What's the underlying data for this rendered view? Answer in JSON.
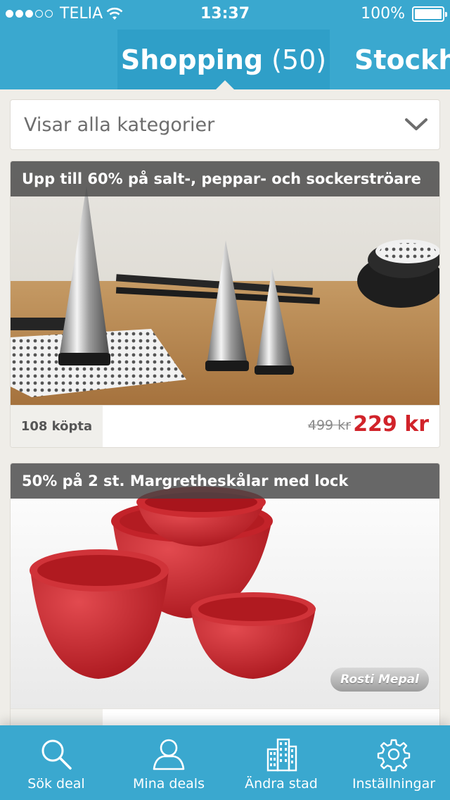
{
  "status_bar": {
    "carrier": "TELIA",
    "time": "13:37",
    "battery": "100%",
    "signal_bars_filled": 3,
    "signal_bars_total": 5
  },
  "header": {
    "active_tab_title": "Shopping",
    "active_tab_count": "(50)",
    "next_tab_title": "Stockholm",
    "background_color": "#3aa8cf"
  },
  "filter": {
    "value": "Visar alla kategorier",
    "icon": "chevron-down-icon"
  },
  "deals": [
    {
      "title": "Upp till 60% på salt-, peppar- och sockerströare",
      "bought": "108 köpta",
      "old_price": "499 kr",
      "price": "229 kr"
    },
    {
      "title": "50% på 2 st. Margretheskålar med lock",
      "bought": "",
      "old_price": "",
      "price": "",
      "brand_logo": "Rosti Mepal"
    }
  ],
  "tabbar": {
    "items": [
      {
        "label": "Sök deal",
        "icon": "search-icon"
      },
      {
        "label": "Mina deals",
        "icon": "user-icon"
      },
      {
        "label": "Ändra stad",
        "icon": "city-icon"
      },
      {
        "label": "Inställningar",
        "icon": "gear-icon"
      }
    ]
  },
  "colors": {
    "accent": "#3aa8cf",
    "price_red": "#d1232a",
    "background": "#efede8"
  }
}
